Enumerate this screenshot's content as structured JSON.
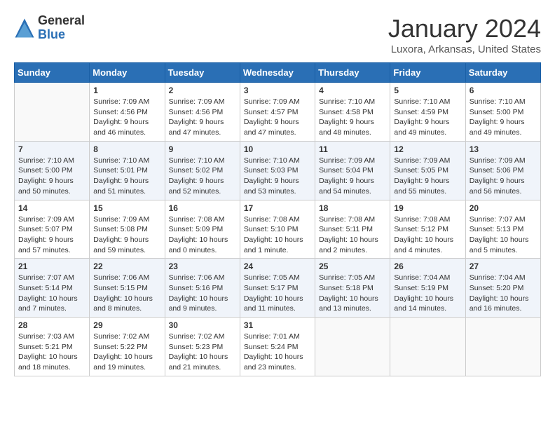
{
  "logo": {
    "general": "General",
    "blue": "Blue"
  },
  "title": "January 2024",
  "subtitle": "Luxora, Arkansas, United States",
  "days_of_week": [
    "Sunday",
    "Monday",
    "Tuesday",
    "Wednesday",
    "Thursday",
    "Friday",
    "Saturday"
  ],
  "weeks": [
    [
      {
        "day": "",
        "info": ""
      },
      {
        "day": "1",
        "info": "Sunrise: 7:09 AM\nSunset: 4:56 PM\nDaylight: 9 hours\nand 46 minutes."
      },
      {
        "day": "2",
        "info": "Sunrise: 7:09 AM\nSunset: 4:56 PM\nDaylight: 9 hours\nand 47 minutes."
      },
      {
        "day": "3",
        "info": "Sunrise: 7:09 AM\nSunset: 4:57 PM\nDaylight: 9 hours\nand 47 minutes."
      },
      {
        "day": "4",
        "info": "Sunrise: 7:10 AM\nSunset: 4:58 PM\nDaylight: 9 hours\nand 48 minutes."
      },
      {
        "day": "5",
        "info": "Sunrise: 7:10 AM\nSunset: 4:59 PM\nDaylight: 9 hours\nand 49 minutes."
      },
      {
        "day": "6",
        "info": "Sunrise: 7:10 AM\nSunset: 5:00 PM\nDaylight: 9 hours\nand 49 minutes."
      }
    ],
    [
      {
        "day": "7",
        "info": "Sunrise: 7:10 AM\nSunset: 5:00 PM\nDaylight: 9 hours\nand 50 minutes."
      },
      {
        "day": "8",
        "info": "Sunrise: 7:10 AM\nSunset: 5:01 PM\nDaylight: 9 hours\nand 51 minutes."
      },
      {
        "day": "9",
        "info": "Sunrise: 7:10 AM\nSunset: 5:02 PM\nDaylight: 9 hours\nand 52 minutes."
      },
      {
        "day": "10",
        "info": "Sunrise: 7:10 AM\nSunset: 5:03 PM\nDaylight: 9 hours\nand 53 minutes."
      },
      {
        "day": "11",
        "info": "Sunrise: 7:09 AM\nSunset: 5:04 PM\nDaylight: 9 hours\nand 54 minutes."
      },
      {
        "day": "12",
        "info": "Sunrise: 7:09 AM\nSunset: 5:05 PM\nDaylight: 9 hours\nand 55 minutes."
      },
      {
        "day": "13",
        "info": "Sunrise: 7:09 AM\nSunset: 5:06 PM\nDaylight: 9 hours\nand 56 minutes."
      }
    ],
    [
      {
        "day": "14",
        "info": "Sunrise: 7:09 AM\nSunset: 5:07 PM\nDaylight: 9 hours\nand 57 minutes."
      },
      {
        "day": "15",
        "info": "Sunrise: 7:09 AM\nSunset: 5:08 PM\nDaylight: 9 hours\nand 59 minutes."
      },
      {
        "day": "16",
        "info": "Sunrise: 7:08 AM\nSunset: 5:09 PM\nDaylight: 10 hours\nand 0 minutes."
      },
      {
        "day": "17",
        "info": "Sunrise: 7:08 AM\nSunset: 5:10 PM\nDaylight: 10 hours\nand 1 minute."
      },
      {
        "day": "18",
        "info": "Sunrise: 7:08 AM\nSunset: 5:11 PM\nDaylight: 10 hours\nand 2 minutes."
      },
      {
        "day": "19",
        "info": "Sunrise: 7:08 AM\nSunset: 5:12 PM\nDaylight: 10 hours\nand 4 minutes."
      },
      {
        "day": "20",
        "info": "Sunrise: 7:07 AM\nSunset: 5:13 PM\nDaylight: 10 hours\nand 5 minutes."
      }
    ],
    [
      {
        "day": "21",
        "info": "Sunrise: 7:07 AM\nSunset: 5:14 PM\nDaylight: 10 hours\nand 7 minutes."
      },
      {
        "day": "22",
        "info": "Sunrise: 7:06 AM\nSunset: 5:15 PM\nDaylight: 10 hours\nand 8 minutes."
      },
      {
        "day": "23",
        "info": "Sunrise: 7:06 AM\nSunset: 5:16 PM\nDaylight: 10 hours\nand 9 minutes."
      },
      {
        "day": "24",
        "info": "Sunrise: 7:05 AM\nSunset: 5:17 PM\nDaylight: 10 hours\nand 11 minutes."
      },
      {
        "day": "25",
        "info": "Sunrise: 7:05 AM\nSunset: 5:18 PM\nDaylight: 10 hours\nand 13 minutes."
      },
      {
        "day": "26",
        "info": "Sunrise: 7:04 AM\nSunset: 5:19 PM\nDaylight: 10 hours\nand 14 minutes."
      },
      {
        "day": "27",
        "info": "Sunrise: 7:04 AM\nSunset: 5:20 PM\nDaylight: 10 hours\nand 16 minutes."
      }
    ],
    [
      {
        "day": "28",
        "info": "Sunrise: 7:03 AM\nSunset: 5:21 PM\nDaylight: 10 hours\nand 18 minutes."
      },
      {
        "day": "29",
        "info": "Sunrise: 7:02 AM\nSunset: 5:22 PM\nDaylight: 10 hours\nand 19 minutes."
      },
      {
        "day": "30",
        "info": "Sunrise: 7:02 AM\nSunset: 5:23 PM\nDaylight: 10 hours\nand 21 minutes."
      },
      {
        "day": "31",
        "info": "Sunrise: 7:01 AM\nSunset: 5:24 PM\nDaylight: 10 hours\nand 23 minutes."
      },
      {
        "day": "",
        "info": ""
      },
      {
        "day": "",
        "info": ""
      },
      {
        "day": "",
        "info": ""
      }
    ]
  ]
}
